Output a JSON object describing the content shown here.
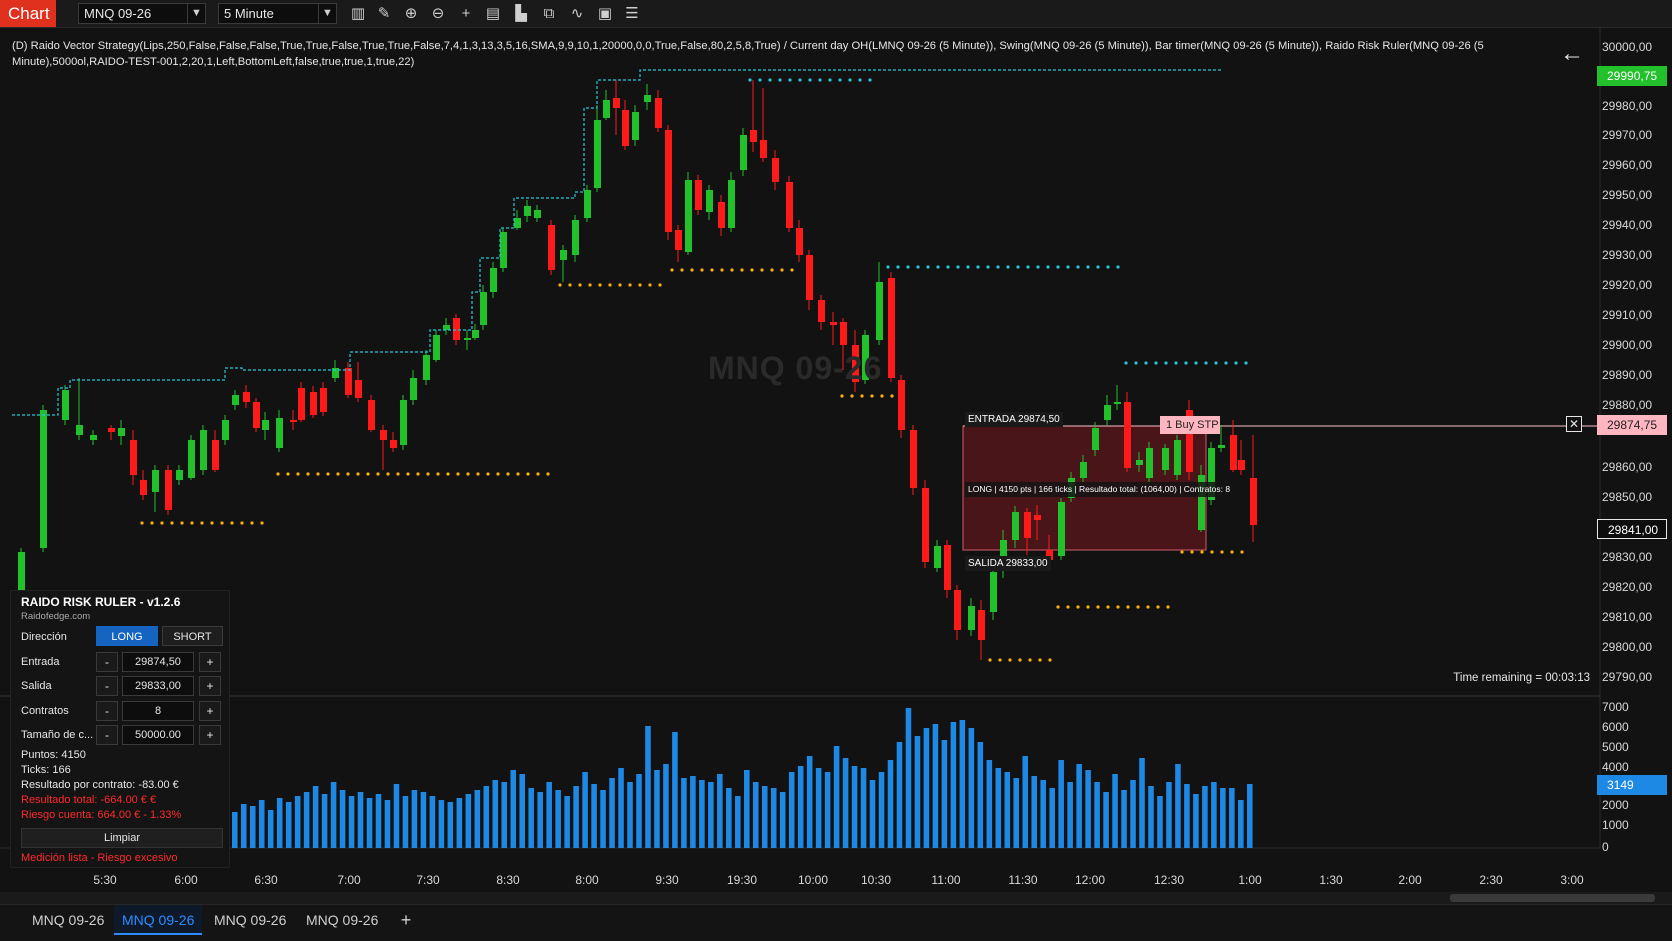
{
  "toolbar": {
    "chart_tab": "Chart",
    "instrument": "MNQ 09-26",
    "interval": "5 Minute",
    "icons": [
      "bar-type-icon",
      "draw-pencil-icon",
      "zoom-in-icon",
      "zoom-out-icon",
      "crosshair-icon",
      "properties-icon",
      "data-box-icon",
      "strategy-icon",
      "indicator-icon",
      "template-icon",
      "list-icon"
    ]
  },
  "indicator_text": "(D) Raido Vector Strategy(Lips,250,False,False,False,True,True,False,True,True,False,7,4,1,3,13,3,5,16,SMA,9,9,10,1,20000,0,0,True,False,80,2,5,8,True) / Current day OH(LMNQ 09-26 (5 Minute)), Swing(MNQ 09-26 (5 Minute)), Bar timer(MNQ 09-26 (5 Minute)), Raido Risk Ruler(MNQ 09-26 (5 Minute),5000ol,RAIDO-TEST-001,2,20,1,Left,BottomLeft,false,true,true,1,true,22)",
  "watermark": "MNQ 09-26",
  "time_remaining": "Time remaining = 00:03:13",
  "entry_tag": "ENTRADA  29874,50",
  "exit_tag": "SALIDA  29833,00",
  "trade_info": "LONG  |  4150 pts  |  166 ticks  |  Resultado total: (1064,00)  |  Contratos: 8",
  "order_tag": "1 Buy STP",
  "price_axis": {
    "labels": [
      "30000,00",
      "29980,00",
      "29970,00",
      "29960,00",
      "29950,00",
      "29940,00",
      "29930,00",
      "29920,00",
      "29910,00",
      "29900,00",
      "29890,00",
      "29880,00",
      "29860,00",
      "29850,00",
      "29830,00",
      "29820,00",
      "29810,00",
      "29800,00",
      "29790,00"
    ],
    "high_marker": "29990,75",
    "entry_marker": "29874,75",
    "last_marker": "29841,00",
    "volume_labels": [
      "7000",
      "6000",
      "5000",
      "4000",
      "2000",
      "1000",
      "0"
    ],
    "volume_marker": "3149"
  },
  "time_axis": [
    "5:30",
    "6:00",
    "6:30",
    "7:00",
    "7:30",
    "8:30",
    "8:00",
    "9:30",
    "19:30",
    "10:00",
    "10:30",
    "11:00",
    "11:30",
    "12:00",
    "12:30",
    "1:00",
    "1:30",
    "2:00",
    "2:30",
    "3:00"
  ],
  "risk_ruler": {
    "title": "RAIDO RISK RULER - v1.2.6",
    "subtitle": "Raidofedge.com",
    "direction_label": "Dirección",
    "long_label": "LONG",
    "short_label": "SHORT",
    "entry_label": "Entrada",
    "entry_value": "29874,50",
    "exit_label": "Salida",
    "exit_value": "29833,00",
    "contracts_label": "Contratos",
    "contracts_value": "8",
    "size_label": "Tamaño de c...",
    "size_value": "50000.00",
    "minus": "-",
    "plus": "+",
    "points": "Puntos: 4150",
    "ticks": "Ticks: 166",
    "per_contract": "Resultado por contrato: -83.00 €",
    "total": "Resultado total: -664.00 € €",
    "risk": "Riesgo cuenta: 664.00 € - 1.33%",
    "clear_label": "Limpiar",
    "status": "Medición lista - Riesgo excesivo"
  },
  "bottom_tabs": [
    "MNQ 09-26",
    "MNQ 09-26",
    "MNQ 09-26",
    "MNQ 09-26"
  ],
  "bottom_plus": "+",
  "colors": {
    "up": "#22c02a",
    "down": "#ff1a1a",
    "volume": "#1e88e5",
    "teal": "#26c6da",
    "amber": "#f9b208",
    "accent": "#1565c0",
    "chart_tab": "#e0301e"
  }
}
